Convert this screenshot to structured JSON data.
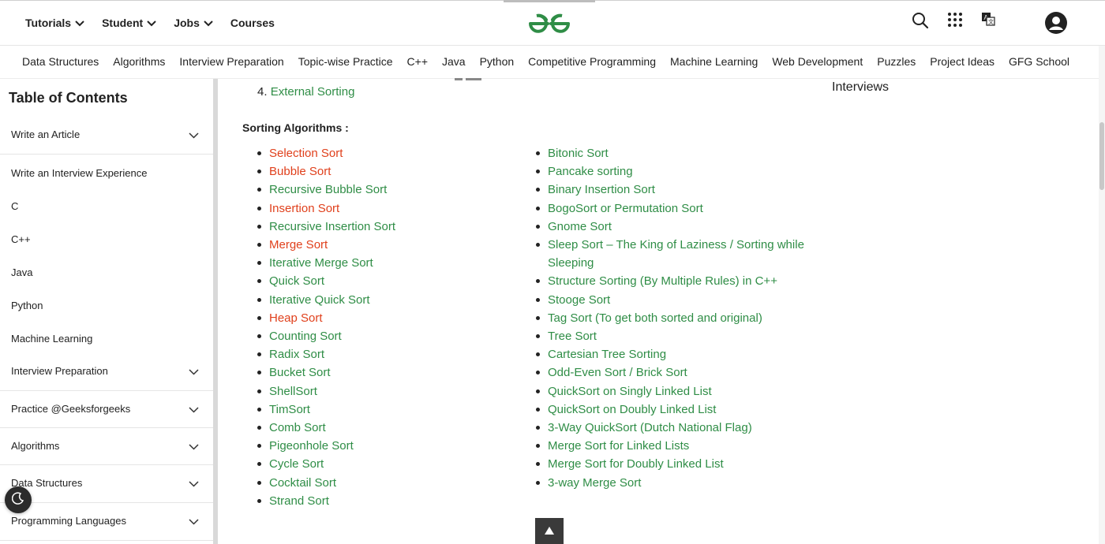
{
  "topnav": {
    "items": [
      {
        "label": "Tutorials",
        "dropdown": true
      },
      {
        "label": "Student",
        "dropdown": true
      },
      {
        "label": "Jobs",
        "dropdown": true
      },
      {
        "label": "Courses",
        "dropdown": false
      }
    ]
  },
  "header_icons": [
    "search-icon",
    "apps-grid-icon",
    "translate-icon",
    "user-avatar-icon"
  ],
  "brand_color": "#2f8d46",
  "catnav": {
    "items": [
      "Data Structures",
      "Algorithms",
      "Interview Preparation",
      "Topic-wise Practice",
      "C++",
      "Java",
      "Python",
      "Competitive Programming",
      "Machine Learning",
      "Web Development",
      "Puzzles",
      "Project Ideas",
      "GFG School"
    ]
  },
  "sidebar": {
    "title": "Table of Contents",
    "items": [
      {
        "label": "Write an Article",
        "expandable": true
      },
      {
        "label": "Write an Interview Experience",
        "expandable": false
      },
      {
        "label": "C",
        "expandable": false
      },
      {
        "label": "C++",
        "expandable": false
      },
      {
        "label": "Java",
        "expandable": false
      },
      {
        "label": "Python",
        "expandable": false
      },
      {
        "label": "Machine Learning",
        "expandable": false
      },
      {
        "label": "Interview Preparation",
        "expandable": true
      },
      {
        "label": "Practice @Geeksforgeeks",
        "expandable": true
      },
      {
        "label": "Algorithms",
        "expandable": true
      },
      {
        "label": "Data Structures",
        "expandable": true
      },
      {
        "label": "Programming Languages",
        "expandable": true
      }
    ]
  },
  "main": {
    "list_item": {
      "number": "4.",
      "label": "External Sorting"
    },
    "side_heading": "Interviews",
    "section_heading": "Sorting Algorithms :",
    "left_list": [
      {
        "label": "Selection Sort",
        "visited": true
      },
      {
        "label": "Bubble Sort",
        "visited": true
      },
      {
        "label": "Recursive Bubble Sort",
        "visited": false
      },
      {
        "label": "Insertion Sort",
        "visited": true
      },
      {
        "label": "Recursive Insertion Sort",
        "visited": false
      },
      {
        "label": "Merge Sort",
        "visited": true
      },
      {
        "label": "Iterative Merge Sort",
        "visited": false
      },
      {
        "label": "Quick Sort",
        "visited": false
      },
      {
        "label": "Iterative Quick Sort",
        "visited": false
      },
      {
        "label": "Heap Sort",
        "visited": true
      },
      {
        "label": "Counting Sort",
        "visited": false
      },
      {
        "label": "Radix Sort",
        "visited": false
      },
      {
        "label": "Bucket Sort",
        "visited": false
      },
      {
        "label": "ShellSort",
        "visited": false
      },
      {
        "label": "TimSort",
        "visited": false
      },
      {
        "label": "Comb Sort",
        "visited": false
      },
      {
        "label": "Pigeonhole Sort",
        "visited": false
      },
      {
        "label": "Cycle Sort",
        "visited": false
      },
      {
        "label": "Cocktail Sort",
        "visited": false
      },
      {
        "label": "Strand Sort",
        "visited": false
      }
    ],
    "right_list": [
      {
        "label": "Bitonic Sort"
      },
      {
        "label": "Pancake sorting"
      },
      {
        "label": "Binary Insertion Sort"
      },
      {
        "label": "BogoSort or Permutation Sort"
      },
      {
        "label": "Gnome Sort"
      },
      {
        "label": "Sleep Sort – The King of Laziness / Sorting while",
        "cont": "Sleeping"
      },
      {
        "label": "Structure Sorting (By Multiple Rules) in C++"
      },
      {
        "label": "Stooge Sort"
      },
      {
        "label": "Tag Sort (To get both sorted and original)"
      },
      {
        "label": "Tree Sort"
      },
      {
        "label": "Cartesian Tree Sorting"
      },
      {
        "label": "Odd-Even Sort / Brick Sort"
      },
      {
        "label": "QuickSort on Singly Linked List"
      },
      {
        "label": "QuickSort on Doubly Linked List"
      },
      {
        "label": "3-Way QuickSort (Dutch National Flag)"
      },
      {
        "label": "Merge Sort for Linked Lists"
      },
      {
        "label": "Merge Sort for Doubly Linked List"
      },
      {
        "label": "3-way Merge Sort"
      }
    ]
  },
  "back_to_top_icon": "arrow-up-icon",
  "darkmode_icon": "moon-icon"
}
